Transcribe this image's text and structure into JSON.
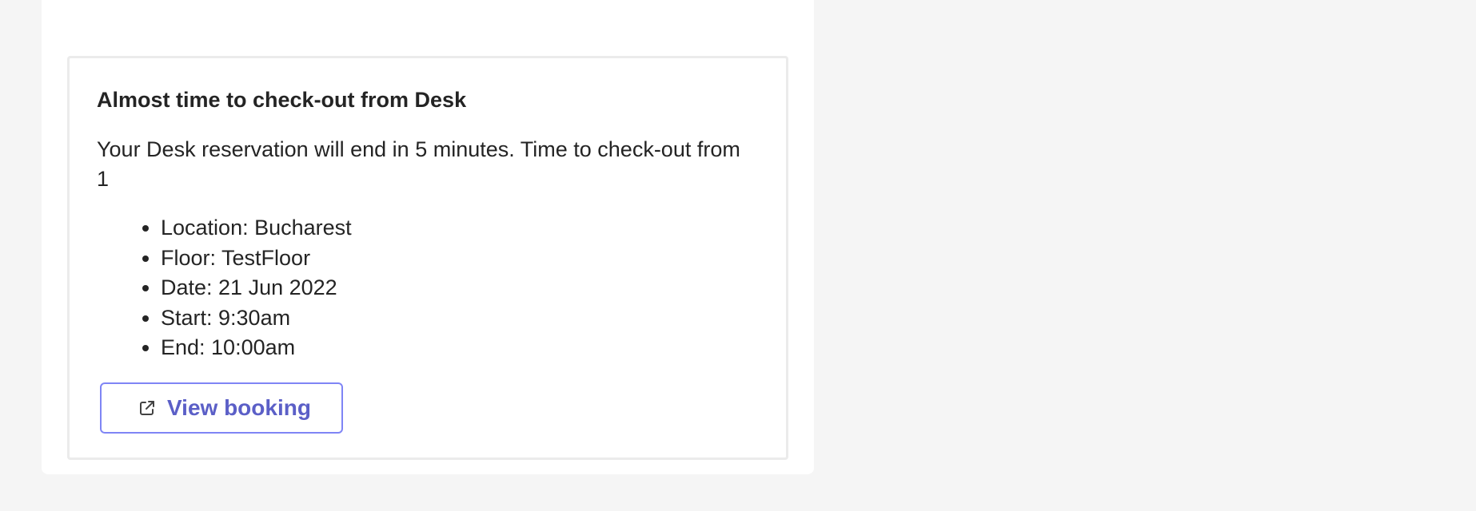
{
  "card": {
    "title": "Almost time to check-out from Desk",
    "body": "Your Desk reservation will end in 5 minutes. Time to check-out from 1",
    "details": [
      "Location: Bucharest",
      "Floor: TestFloor",
      "Date: 21 Jun 2022",
      "Start: 9:30am",
      "End: 10:00am"
    ],
    "action": {
      "label": "View booking",
      "icon": "external-link-icon"
    }
  },
  "colors": {
    "page_background": "#f5f5f5",
    "panel_background": "#ffffff",
    "card_border": "#ebebeb",
    "text": "#242424",
    "button_border": "#7f85f5",
    "button_text": "#5b5fc7"
  }
}
